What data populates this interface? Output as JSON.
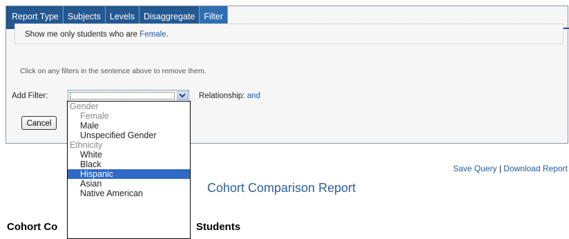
{
  "tabs": [
    {
      "label": "Report Type"
    },
    {
      "label": "Subjects"
    },
    {
      "label": "Levels"
    },
    {
      "label": "Disaggregate"
    },
    {
      "label": "Filter"
    }
  ],
  "active_tab": "Filter",
  "filter": {
    "sentence_prefix": "Show me only students who are ",
    "sentence_value": "Female",
    "sentence_suffix": ".",
    "hint": "Click on any filters in the sentence above to remove them.",
    "add_filter_label": "Add Filter:",
    "relationship_label": "Relationship: ",
    "relationship_value": "and",
    "cancel_label": "Cancel"
  },
  "dropdown": {
    "options": [
      {
        "label": "Gender",
        "kind": "group"
      },
      {
        "label": "Female",
        "kind": "disabled"
      },
      {
        "label": "Male",
        "kind": "child"
      },
      {
        "label": "Unspecified Gender",
        "kind": "child"
      },
      {
        "label": "Ethnicity",
        "kind": "group"
      },
      {
        "label": "White",
        "kind": "child"
      },
      {
        "label": "Black",
        "kind": "child"
      },
      {
        "label": "Hispanic",
        "kind": "child",
        "selected": true
      },
      {
        "label": "Asian",
        "kind": "child"
      },
      {
        "label": "Native American",
        "kind": "child"
      }
    ]
  },
  "actions": {
    "save_query": "Save Query",
    "separator": " | ",
    "download_report": "Download Report"
  },
  "report": {
    "title": "Cohort Comparison Report",
    "section_left": "Cohort Co",
    "section_right": "Students"
  },
  "colors": {
    "tab_bar": "#1f4f8a",
    "link": "#1c5aa8",
    "selection": "#316ac5"
  }
}
